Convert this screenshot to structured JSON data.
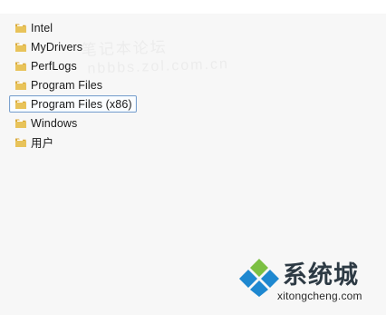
{
  "files": [
    {
      "label": "Intel",
      "icon": "folder-icon",
      "selected": false
    },
    {
      "label": "MyDrivers",
      "icon": "folder-icon",
      "selected": false
    },
    {
      "label": "PerfLogs",
      "icon": "folder-icon",
      "selected": false
    },
    {
      "label": "Program Files",
      "icon": "folder-icon",
      "selected": false
    },
    {
      "label": "Program Files (x86)",
      "icon": "folder-icon",
      "selected": true
    },
    {
      "label": "Windows",
      "icon": "folder-icon",
      "selected": false
    },
    {
      "label": "用户",
      "icon": "folder-icon",
      "selected": false
    }
  ],
  "watermark": {
    "line1": "笔记本论坛",
    "line2": "nbbbs.zol.com.cn"
  },
  "brand": {
    "name": "系统城",
    "domain": "xitongcheng.com"
  },
  "colors": {
    "selection_border": "#7da2ce",
    "folder_body": "#e8c35a",
    "folder_tab": "#d9a93a",
    "logo_blue": "#1e88d0",
    "logo_green": "#7cc043"
  }
}
